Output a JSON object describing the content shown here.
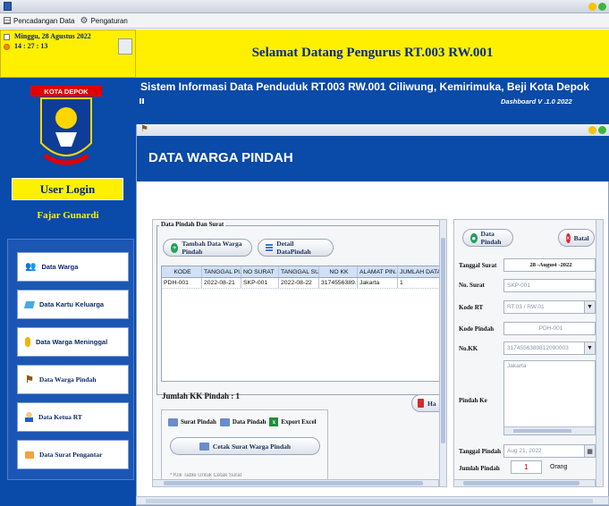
{
  "window": {
    "title": ""
  },
  "menu": {
    "items": [
      "Pencadangan Data",
      "Pengaturan"
    ]
  },
  "datetime": {
    "date": "Minggu, 28 Agustus 2022",
    "time": "14 : 27 : 13"
  },
  "welcome": "Selamat Datang Pengurus RT.003 RW.001",
  "sidebar": {
    "logo_caption": "KOTA DEPOK",
    "user_login": "User Login",
    "username": "Fajar Gunardi",
    "items": [
      {
        "label": "Data Warga",
        "icon": "people-icon"
      },
      {
        "label": "Data Kartu Keluarga",
        "icon": "card-icon"
      },
      {
        "label": "Data Warga Meninggal",
        "icon": "person-icon"
      },
      {
        "label": "Data Warga Pindah",
        "icon": "signpost-icon"
      },
      {
        "label": "Data Ketua RT",
        "icon": "user-icon"
      },
      {
        "label": "Data Surat Pengantar",
        "icon": "folder-icon"
      }
    ]
  },
  "header": {
    "system_info": "Sistem Informasi Data Penduduk RT.003 RW.001 Ciliwung, Kemirimuka, Beji Kota Depok",
    "version": "Dashboard V .1.0 2022"
  },
  "page": {
    "title": "DATA WARGA PINDAH",
    "group_title": "Data Pindah Dan Surat",
    "btn_tambah": "Tambah Data Warga Pindah",
    "btn_detail": "Detail DataPindah",
    "table": {
      "columns": [
        "KODE",
        "TANGGAL PI...",
        "NO SURAT",
        "TANGGAL SU...",
        "NO KK",
        "ALAMAT PIN...",
        "JUMLAH DATA"
      ],
      "rows": [
        [
          "PDH-001",
          "2022-08-21",
          "SKP-001",
          "2022-08-22",
          "3174556389...",
          "Jakarta",
          "1"
        ]
      ]
    },
    "count_label": "Jumlah KK Pindah : 1",
    "btn_hapus": "Ha",
    "tabs": [
      "Surat Pindah",
      "Data Pindah",
      "Export Excel"
    ],
    "btn_cetak": "Cetak Surat Warga Pindah",
    "footnote": "* Klik Table Untuk Cetak Surat"
  },
  "detail": {
    "btn_data_pindah": "Data Pindah",
    "btn_batal": "Batal",
    "labels": {
      "tanggal_surat": "Tanggal Surat",
      "no_surat": "No. Surat",
      "kode_rt": "Kode RT",
      "kode_pindah": "Kode Pindah",
      "no_kk": "No.KK",
      "pindah_ke": "Pindah Ke",
      "tanggal_pindah": "Tanggal Pindah",
      "jumlah_pindah": "Jumlah Pindah",
      "orang": "Orang"
    },
    "values": {
      "tanggal_surat": "28 -August -2022",
      "no_surat": "SKP-001",
      "kode_rt": "RT.03 / RW.01",
      "kode_pindah": "PDH-001",
      "no_kk": "3174556389812090003",
      "pindah_ke": "Jakarta",
      "tanggal_pindah": "Aug 21, 2022",
      "jumlah_pindah": "1"
    }
  },
  "colors": {
    "primary": "#0A4AA8",
    "accent": "#FFF000"
  }
}
